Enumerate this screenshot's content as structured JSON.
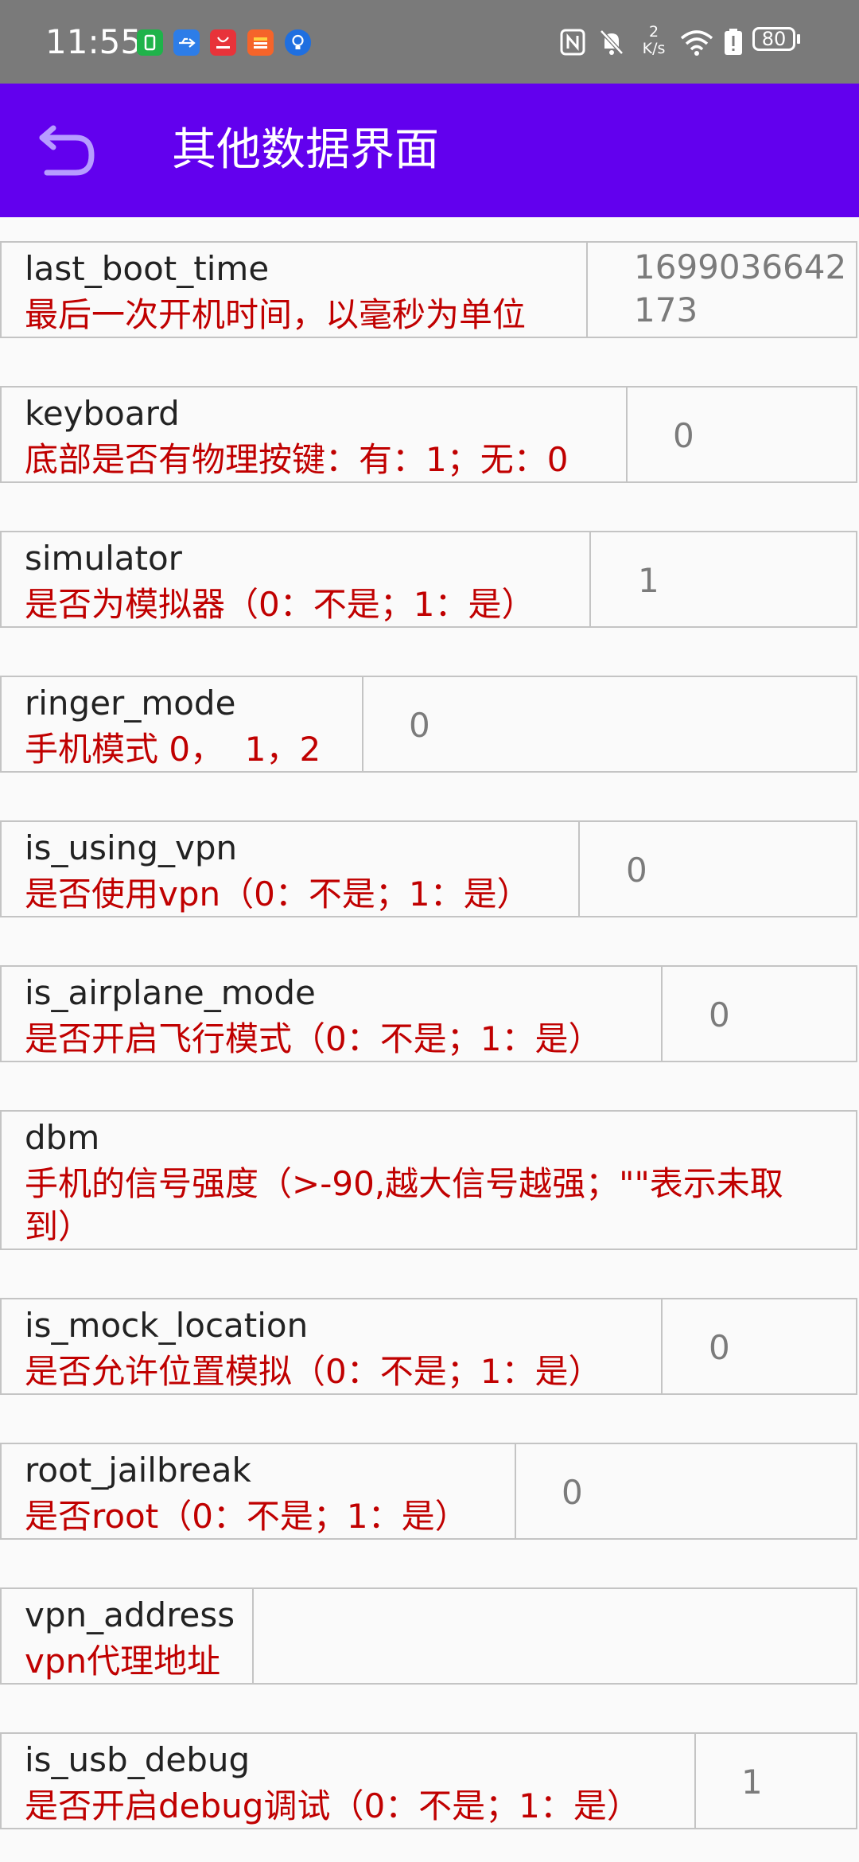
{
  "status_bar": {
    "time": "11:55",
    "battery_level": "80",
    "network_speed_value": "2",
    "network_speed_unit": "K/s",
    "notification_icons": [
      "sim-icon",
      "usb-icon",
      "huawei-app-icon",
      "app-icon",
      "lightbulb-icon"
    ],
    "system_icons": [
      "nfc-icon",
      "mute-icon",
      "network-speed-icon",
      "wifi-icon",
      "battery-alert-icon",
      "battery-icon"
    ]
  },
  "app_bar": {
    "title": "其他数据界面",
    "back_icon": "back-icon"
  },
  "colors": {
    "app_bar": "#6200ee",
    "status_bar": "#7a7a7a",
    "key_text": "#222222",
    "desc_text": "#c00000",
    "value_text": "#7b7b7b",
    "border": "#c4c4c4"
  },
  "rows": [
    {
      "key": "last_boot_time",
      "desc": "最后一次开机时间，以毫秒为单位",
      "value": "1699036642173"
    },
    {
      "key": "keyboard",
      "desc": "底部是否有物理按键：有：1；无：0",
      "value": "0"
    },
    {
      "key": "simulator",
      "desc": "是否为模拟器（0：不是；1：是）",
      "value": "1"
    },
    {
      "key": "ringer_mode",
      "desc": "手机模式 0，  1，2",
      "value": "0"
    },
    {
      "key": "is_using_vpn",
      "desc": "是否使用vpn（0：不是；1：是）",
      "value": "0"
    },
    {
      "key": "is_airplane_mode",
      "desc": "是否开启飞行模式（0：不是；1：是）",
      "value": "0"
    },
    {
      "key": "dbm",
      "desc": "手机的信号强度（>-90,越大信号越强；\"\"表示未取到）",
      "value": ""
    },
    {
      "key": "is_mock_location",
      "desc": "是否允许位置模拟（0：不是；1：是）",
      "value": "0"
    },
    {
      "key": "root_jailbreak",
      "desc": "是否root（0：不是；1：是）",
      "value": "0"
    },
    {
      "key": "vpn_address",
      "desc": "vpn代理地址",
      "value": ""
    },
    {
      "key": "is_usb_debug",
      "desc": "是否开启debug调试（0：不是；1：是）",
      "value": "1"
    }
  ]
}
